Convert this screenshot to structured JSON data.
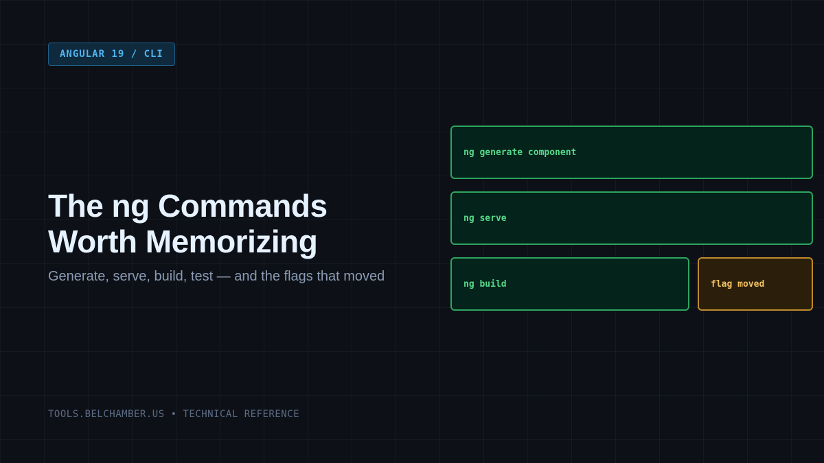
{
  "badge": {
    "label": "ANGULAR 19 / CLI"
  },
  "hero": {
    "title_line1": "The ng Commands",
    "title_line2": "Worth Memorizing",
    "subtitle": "Generate, serve, build, test — and the flags that moved"
  },
  "commands": [
    {
      "label": "ng generate component",
      "status": "ok"
    },
    {
      "label": "ng serve",
      "status": "ok"
    },
    {
      "label": "ng build",
      "status": "ok"
    },
    {
      "label": "flag moved",
      "status": "warning"
    }
  ],
  "footer": {
    "text": "TOOLS.BELCHAMBER.US • TECHNICAL REFERENCE"
  },
  "colors": {
    "background": "#0d1117",
    "accent_blue": "#4fb3f0",
    "ok_green": "#56d98a",
    "warning_amber": "#f0c060",
    "title": "#e6f2ff",
    "muted": "#8b9bb4"
  }
}
